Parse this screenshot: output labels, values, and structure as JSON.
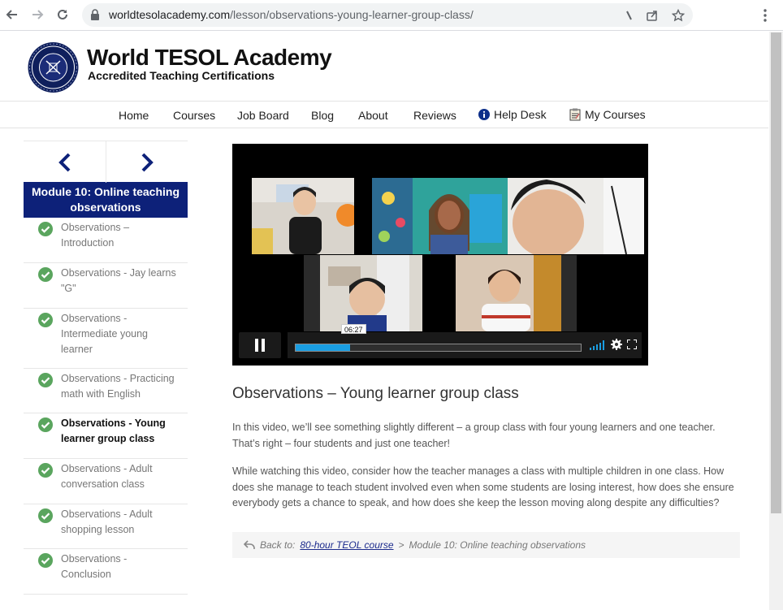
{
  "browser": {
    "url_domain": "worldtesolacademy.com",
    "url_path": "/lesson/observations-young-learner-group-class/"
  },
  "brand": {
    "name": "World TESOL Academy",
    "tagline": "Accredited Teaching Certifications"
  },
  "nav": {
    "items": [
      "Home",
      "Courses",
      "Job Board",
      "Blog",
      "About",
      "Reviews",
      "Help Desk",
      "My Courses"
    ],
    "icons": {
      "Help Desk": "info-circle-icon",
      "My Courses": "clipboard-icon"
    }
  },
  "sidebar": {
    "module_title": "Module 10: Online teaching observations",
    "lessons": [
      {
        "label": "Observations – Introduction",
        "completed": true
      },
      {
        "label": "Observations - Jay learns \"G\"",
        "completed": true
      },
      {
        "label": "Observations - Intermediate young learner",
        "completed": true
      },
      {
        "label": "Observations - Practicing math with English",
        "completed": true
      },
      {
        "label": "Observations - Young learner group class",
        "completed": true,
        "active": true
      },
      {
        "label": "Observations - Adult conversation class",
        "completed": true
      },
      {
        "label": "Observations - Adult shopping lesson",
        "completed": true
      },
      {
        "label": "Observations - Conclusion",
        "completed": true
      }
    ]
  },
  "video": {
    "time_tooltip": "06:27",
    "progress": 0.19
  },
  "lesson": {
    "title": "Observations – Young learner group class",
    "paragraphs": [
      "In this video, we’ll see something slightly different – a group class with four young learners and one teacher. That’s right – four students and just one teacher!",
      "While watching this video, consider how the teacher manages a class with multiple children in one class. How does she manage to teach student involved even when some students are losing interest, how does she ensure everybody gets a chance to speak, and how does she keep the lesson moving along despite any difficulties?"
    ],
    "back_prefix": "Back to:",
    "back_course": "80-hour TEOL course",
    "back_separator": ">",
    "back_module": "Module 10: Online teaching observations"
  },
  "colors": {
    "module_bg": "#0d2179",
    "check_green": "#5aa55e",
    "progress_blue": "#1a9ee2"
  }
}
